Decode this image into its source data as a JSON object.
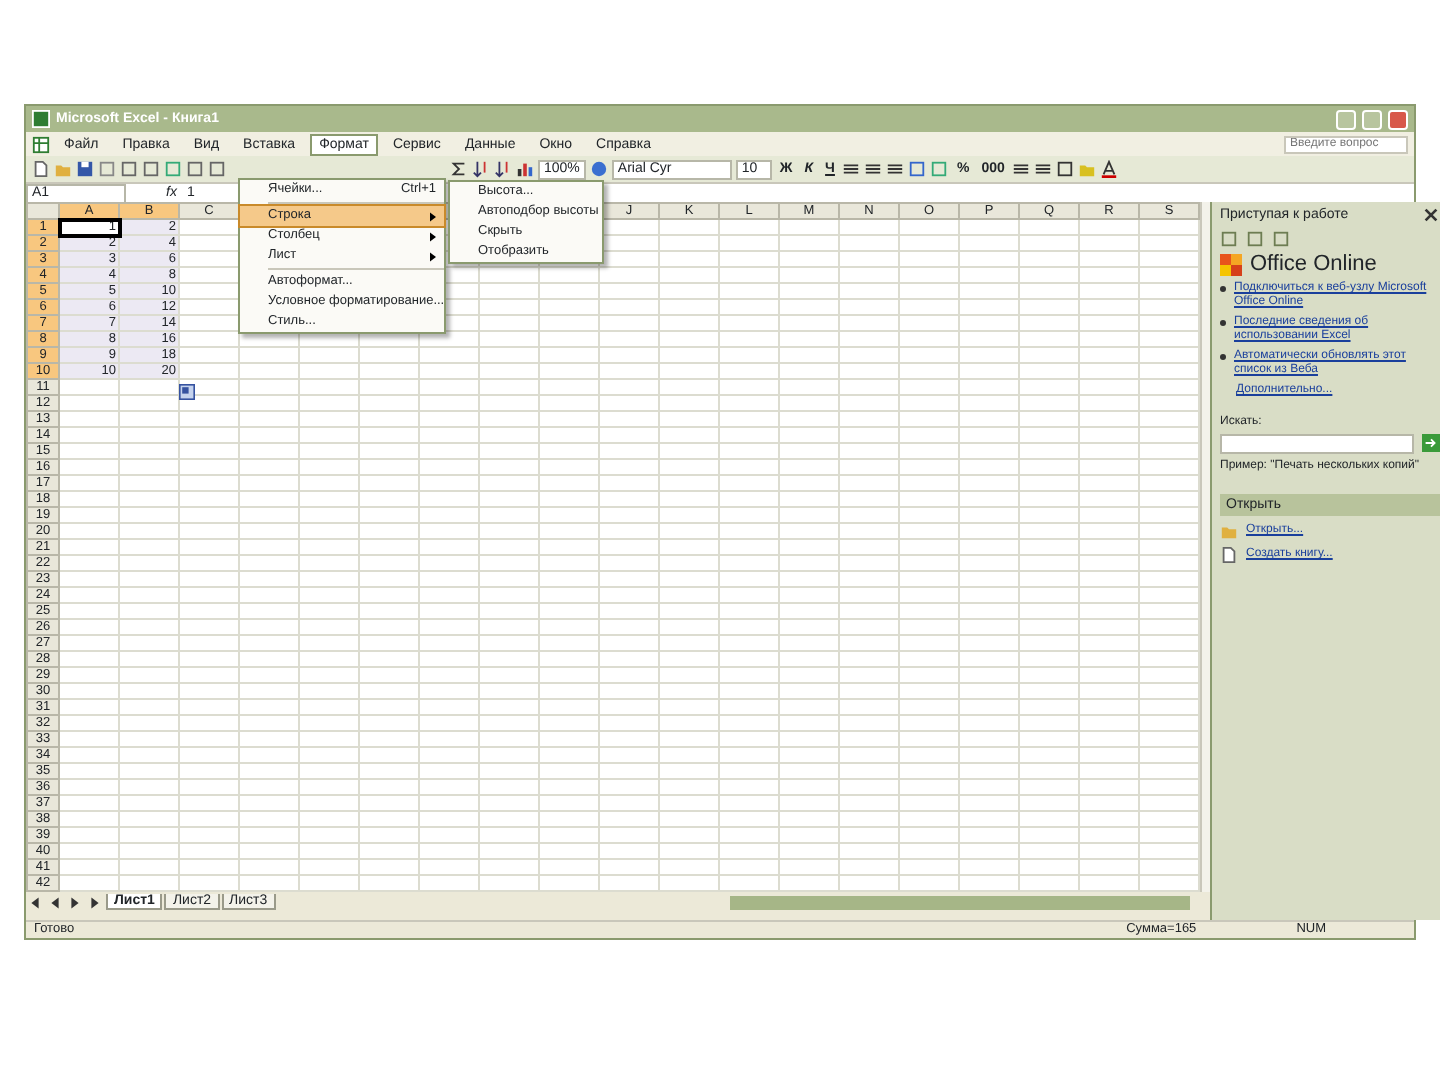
{
  "window": {
    "title": "Microsoft Excel - Книга1"
  },
  "menu": [
    {
      "label": "Файл",
      "selected": false
    },
    {
      "label": "Правка",
      "selected": false
    },
    {
      "label": "Вид",
      "selected": false
    },
    {
      "label": "Вставка",
      "selected": false
    },
    {
      "label": "Формат",
      "selected": true
    },
    {
      "label": "Сервис",
      "selected": false
    },
    {
      "label": "Данные",
      "selected": false
    },
    {
      "label": "Окно",
      "selected": false
    },
    {
      "label": "Справка",
      "selected": false
    }
  ],
  "help_box": {
    "placeholder": "Введите вопрос"
  },
  "toolbar": {
    "zoom": "100%",
    "font": "Arial Cyr",
    "size": "10",
    "format_buttons": [
      "Ж",
      "К",
      "Ч"
    ],
    "number_buttons": [
      "%",
      "000"
    ]
  },
  "formula_bar": {
    "name_box": "A1",
    "fx": "fx",
    "value": "1"
  },
  "format_menu": [
    {
      "kind": "item",
      "label": "Ячейки...",
      "shortcut": "Ctrl+1",
      "selected": false
    },
    {
      "kind": "submenu",
      "label": "Строка",
      "selected": true
    },
    {
      "kind": "submenu",
      "label": "Столбец",
      "selected": false
    },
    {
      "kind": "submenu",
      "label": "Лист",
      "selected": false
    },
    {
      "kind": "item",
      "label": "Автоформат...",
      "selected": false
    },
    {
      "kind": "item",
      "label": "Условное форматирование...",
      "selected": false
    },
    {
      "kind": "item",
      "label": "Стиль...",
      "selected": false
    }
  ],
  "row_submenu": [
    "Высота...",
    "Автоподбор высоты",
    "Скрыть",
    "Отобразить"
  ],
  "sheet": {
    "columns": [
      {
        "label": "A",
        "selected": true
      },
      {
        "label": "B",
        "selected": true
      },
      {
        "label": "C",
        "selected": false
      }
    ],
    "columns_after_menu": [
      {
        "label": "J",
        "selected": false
      },
      {
        "label": "K",
        "selected": false
      },
      {
        "label": "L",
        "selected": false
      },
      {
        "label": "M",
        "selected": false
      },
      {
        "label": "N",
        "selected": false
      },
      {
        "label": "O",
        "selected": false
      },
      {
        "label": "P",
        "selected": false
      },
      {
        "label": "Q",
        "selected": false
      },
      {
        "label": "R",
        "selected": false
      },
      {
        "label": "S",
        "selected": false
      }
    ],
    "rows": [
      {
        "header": "1",
        "selected": true,
        "cells": [
          "1",
          "2"
        ]
      },
      {
        "header": "2",
        "selected": true,
        "cells": [
          "2",
          "4"
        ]
      },
      {
        "header": "3",
        "selected": true,
        "cells": [
          "3",
          "6"
        ]
      },
      {
        "header": "4",
        "selected": true,
        "cells": [
          "4",
          "8"
        ]
      },
      {
        "header": "5",
        "selected": true,
        "cells": [
          "5",
          "10"
        ]
      },
      {
        "header": "6",
        "selected": true,
        "cells": [
          "6",
          "12"
        ]
      },
      {
        "header": "7",
        "selected": true,
        "cells": [
          "7",
          "14"
        ]
      },
      {
        "header": "8",
        "selected": true,
        "cells": [
          "8",
          "16"
        ]
      },
      {
        "header": "9",
        "selected": true,
        "cells": [
          "9",
          "18"
        ]
      },
      {
        "header": "10",
        "selected": true,
        "cells": [
          "10",
          "20"
        ]
      },
      {
        "header": "11",
        "selected": false
      },
      {
        "header": "12",
        "selected": false
      },
      {
        "header": "13",
        "selected": false
      },
      {
        "header": "14",
        "selected": false
      },
      {
        "header": "15",
        "selected": false
      },
      {
        "header": "16",
        "selected": false
      },
      {
        "header": "17",
        "selected": false
      },
      {
        "header": "18",
        "selected": false
      },
      {
        "header": "19",
        "selected": false
      },
      {
        "header": "20",
        "selected": false
      },
      {
        "header": "21",
        "selected": false
      },
      {
        "header": "22",
        "selected": false
      },
      {
        "header": "23",
        "selected": false
      },
      {
        "header": "24",
        "selected": false
      },
      {
        "header": "25",
        "selected": false
      },
      {
        "header": "26",
        "selected": false
      },
      {
        "header": "27",
        "selected": false
      },
      {
        "header": "28",
        "selected": false
      },
      {
        "header": "29",
        "selected": false
      },
      {
        "header": "30",
        "selected": false
      },
      {
        "header": "31",
        "selected": false
      },
      {
        "header": "32",
        "selected": false
      },
      {
        "header": "33",
        "selected": false
      },
      {
        "header": "34",
        "selected": false
      },
      {
        "header": "35",
        "selected": false
      },
      {
        "header": "36",
        "selected": false
      },
      {
        "header": "37",
        "selected": false
      },
      {
        "header": "38",
        "selected": false
      },
      {
        "header": "39",
        "selected": false
      },
      {
        "header": "40",
        "selected": false
      },
      {
        "header": "41",
        "selected": false
      },
      {
        "header": "42",
        "selected": false
      }
    ]
  },
  "sheet_tabs": [
    {
      "label": "Лист1",
      "selected": true
    },
    {
      "label": "Лист2",
      "selected": false
    },
    {
      "label": "Лист3",
      "selected": false
    }
  ],
  "task_pane": {
    "title": "Приступая к работе",
    "logo": "Office Online",
    "links": [
      "Подключиться к веб-узлу Microsoft Office Online",
      "Последние сведения об использовании Excel",
      "Автоматически обновлять этот список из Веба"
    ],
    "more": "Дополнительно...",
    "search_label": "Искать:",
    "example": "Пример: \"Печать нескольких копий\"",
    "open_header": "Открыть",
    "open_items": [
      "Открыть...",
      "Создать книгу..."
    ]
  },
  "status_bar": {
    "state": "Готово",
    "sum": "Сумма=165",
    "num": "NUM"
  }
}
